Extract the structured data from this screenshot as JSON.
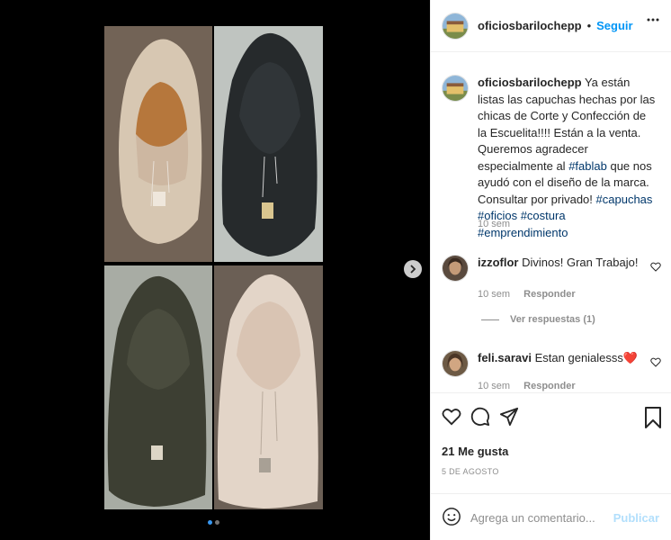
{
  "post": {
    "username": "oficiosbarilochepp",
    "separator": "•",
    "follow_label": "Seguir",
    "more_icon": "more-horizontal-icon"
  },
  "caption": {
    "username": "oficiosbarilochepp",
    "text_1": "Ya están listas las capuchas hechas por las chicas de Corte y Confección de la Escuelita!!!! Están a la venta. Queremos agradecer especialmente al",
    "tag_fablab": "#fablab",
    "text_2": "que nos ayudó con el diseño de la marca. Consultar por privado!",
    "tag_capuchas": "#capuchas",
    "tag_oficios": "#oficios",
    "tag_costura": "#costura",
    "tag_emprendimiento": "#emprendimiento",
    "time": "10 sem"
  },
  "comments": [
    {
      "username": "izzoflor",
      "text": "Divinos! Gran Trabajo!",
      "time": "10 sem",
      "reply_label": "Responder"
    },
    {
      "username": "feli.saravi",
      "text": "Estan genialesss",
      "emoji": "❤️",
      "time": "10 sem",
      "reply_label": "Responder"
    }
  ],
  "view_replies": "Ver respuestas (1)",
  "actions": {
    "likes": "21 Me gusta",
    "date": "5 DE AGOSTO"
  },
  "add_comment": {
    "placeholder": "Agrega un comentario...",
    "publish_label": "Publicar"
  },
  "carousel": {
    "current": 1,
    "total": 2
  },
  "colors": {
    "link_blue": "#0095f6",
    "hashtag": "#00376b",
    "muted": "#8e8e8e",
    "publish_disabled": "#b2dffc",
    "carousel_active": "#3897f0"
  }
}
